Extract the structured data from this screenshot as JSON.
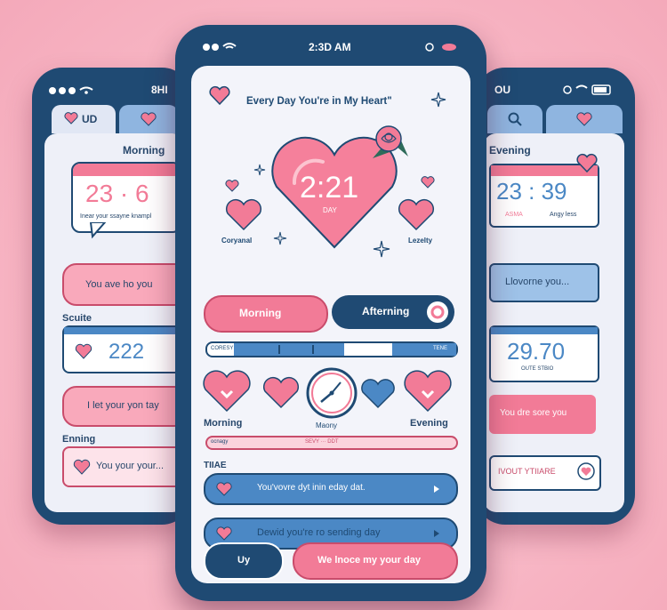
{
  "colors": {
    "navy": "#1f4a73",
    "pink": "#f27b97",
    "light_pink": "#f9a9bb",
    "blue": "#4b88c5",
    "background": "#f7b6c4"
  },
  "left": {
    "status": "8HI",
    "tab": "UD",
    "morning_label": "Morning",
    "clock": "23 · 6",
    "clock_sub": "Inear your ssayne knampl",
    "msg1": "You ave ho you",
    "section": "Scuite",
    "clock2": "222",
    "msg2": "I let your yon tay",
    "evening_label": "Enning",
    "msg3": "You your your..."
  },
  "center": {
    "status_time": "2:3D AM",
    "title": "Every Day You're in My Heart\"",
    "heart_time": "2:21",
    "heart_sub": "DAY",
    "left_label": "Coryanal",
    "right_label": "Lezelty",
    "btn_morning": "Morning",
    "btn_afternoon": "Afterning",
    "slider_left": "CORESY",
    "slider_right": "TENE",
    "morning": "Morning",
    "clock_label": "Maony",
    "evening": "Evening",
    "bar2_left": "ocnagy",
    "bar2_mid": "SEVY ··· DDT",
    "section": "TIIAE",
    "msg1": "You'vovre dyt inin eday dat.",
    "msg2": "Dewid you're ro sending day",
    "btn_left": "Uy",
    "btn_right": "We lnoce my your day"
  },
  "right": {
    "status": "OU",
    "evening_label": "Evening",
    "clock": "23 : 39",
    "clock_sub_left": "ASMA",
    "clock_sub_right": "Angy less",
    "msg1": "Llovorne you...",
    "clock2": "29.70",
    "clock2_sub": "OUTE STBIO",
    "msg2": "You dre sore you",
    "msg3": "IVOUT YTIIARE"
  }
}
